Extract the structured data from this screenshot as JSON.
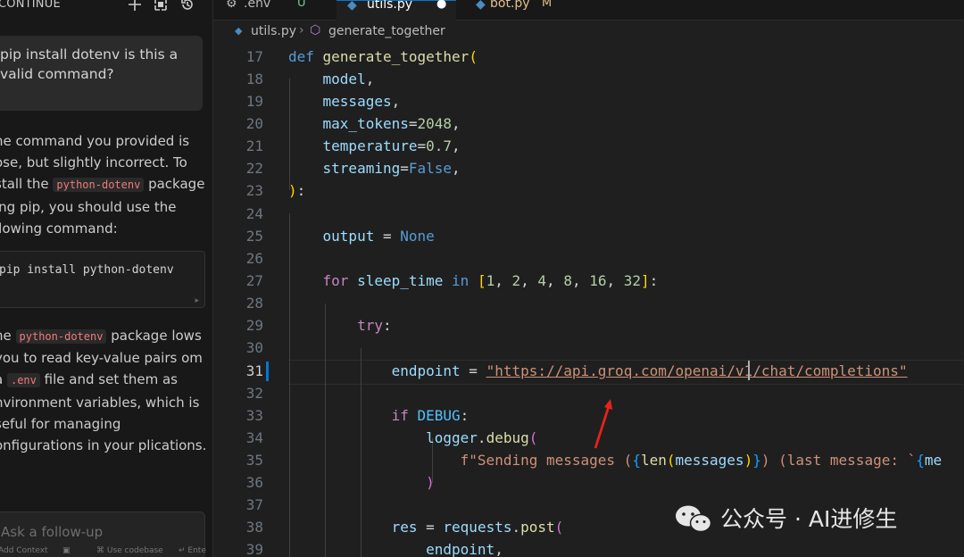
{
  "chat": {
    "title": "CONTINUE",
    "user_message": "pip install dotenv is this a valid command?",
    "reply_1a": "he command you provided is ose, but slightly incorrect. To stall the",
    "reply_1_code": "python-dotenv",
    "reply_1b": "package ing pip, you should use the llowing command:",
    "code_block": "pip install python-dotenv",
    "reply_2_pre": "he",
    "reply_2_code1": "python-dotenv",
    "reply_2_mid": "package lows you to read key-value pairs om a",
    "reply_2_code2": ".env",
    "reply_2_post": "file and set them as nvironment variables, which is seful for managing onfigurations in your plications.",
    "followup_placeholder": "Ask a follow-up",
    "footer_add": "Add Context",
    "footer_codebase": "Use codebase",
    "footer_enter": "Ente"
  },
  "tabs": [
    {
      "name": ".env",
      "status": "U"
    },
    {
      "name": "utils.py",
      "status": "●"
    },
    {
      "name": "bot.py",
      "status": "M"
    }
  ],
  "breadcrumb": {
    "file": "utils.py",
    "symbol": "generate_together"
  },
  "code": {
    "line_numbers": [
      "17",
      "18",
      "19",
      "20",
      "21",
      "22",
      "23",
      "24",
      "25",
      "26",
      "27",
      "28",
      "29",
      "30",
      "31",
      "32",
      "33",
      "34",
      "35",
      "36",
      "37",
      "38",
      "39"
    ],
    "def_kw": "def",
    "func_name": "generate_together",
    "p_model": "model",
    "p_messages": "messages",
    "p_max_tokens": "max_tokens",
    "v_max_tokens": "2048",
    "p_temperature": "temperature",
    "v_temperature": "0.7",
    "p_streaming": "streaming",
    "v_streaming": "False",
    "output_var": "output",
    "none_kw": "None",
    "for_kw": "for",
    "loop_var": "sleep_time",
    "in_kw": "in",
    "sleep_list": [
      "1",
      "2",
      "4",
      "8",
      "16",
      "32"
    ],
    "try_kw": "try",
    "endpoint_var": "endpoint",
    "endpoint_url": "\"https://api.groq.com/openai/v1/chat/completions\"",
    "if_kw": "if",
    "debug_const": "DEBUG",
    "logger_obj": "logger",
    "logger_fn": "debug",
    "fstring_prefix": "f\"Sending messages (",
    "len_fn": "len",
    "len_arg": "messages",
    "fstring_tail": ") (last message: `",
    "fstring_tail2": "me",
    "res_var": "res",
    "requests_obj": "requests",
    "post_fn": "post",
    "endpoint_arg": "endpoint"
  },
  "watermark": "公众号 · AI进修生"
}
